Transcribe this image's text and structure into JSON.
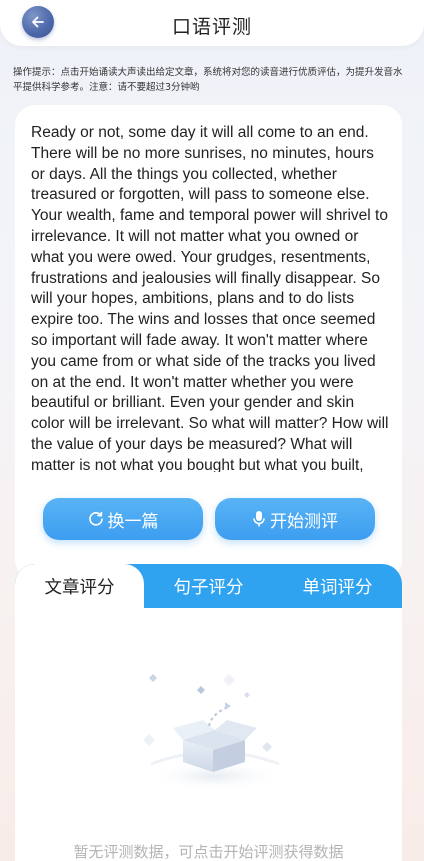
{
  "header": {
    "title": "口语评测",
    "back_icon": "arrow-left-icon"
  },
  "hint": "操作提示：点击开始诵读大声读出给定文章，系统将对您的读音进行优质评估，为提升发音水平提供科学参考。注意：请不要超过3分钟哟",
  "article": {
    "text": "Ready or not, some day it will all come to an end. There will be no more sunrises, no minutes, hours or days. All the things you collected, whether treasured or forgotten, will pass to someone else. Your wealth, fame and temporal power will shrivel to irrelevance. It will not matter what you owned or what you were owed. Your grudges, resentments, frustrations and jealousies will finally disappear. So will your hopes, ambitions, plans and to do lists expire too. The wins and losses that once seemed so important will fade away. It won't matter where you came from or what side of the tracks you lived on at the end. It won't matter whether you were beautiful or brilliant. Even your gender and skin color will be irrelevant. So what will matter? How will the value of your days be measured? What will matter is not what you bought but what you built, not what you got but what you gave. What will matter is not your competence but"
  },
  "buttons": {
    "change_label": "换一篇",
    "change_icon": "refresh-icon",
    "start_label": "开始测评",
    "start_icon": "microphone-icon"
  },
  "tabs": [
    {
      "label": "文章评分",
      "active": true
    },
    {
      "label": "句子评分",
      "active": false
    },
    {
      "label": "单词评分",
      "active": false
    }
  ],
  "empty": {
    "text": "暂无评测数据，可点击开始评测获得数据",
    "icon": "empty-box-icon"
  },
  "colors": {
    "accent": "#3d9df0",
    "tab_bar": "#2fa3f0",
    "back_button": "#4c67a8",
    "empty_text": "#b4b4b4"
  }
}
